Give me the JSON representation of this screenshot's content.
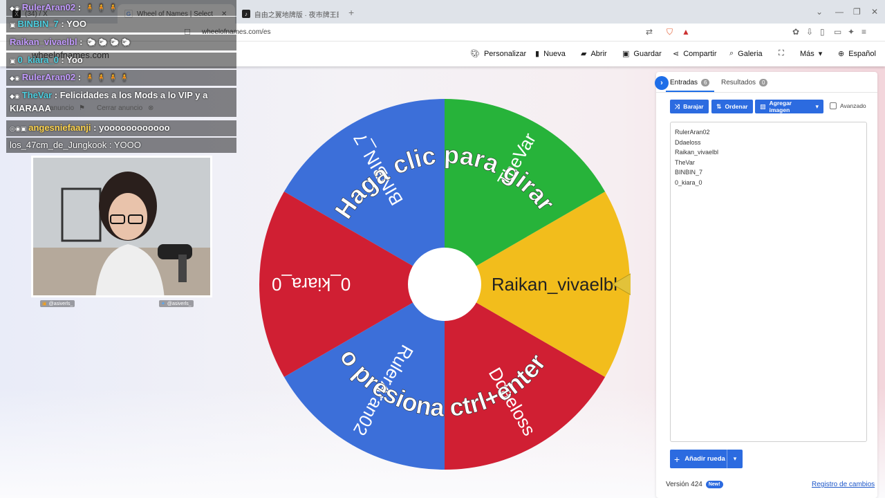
{
  "browser": {
    "tabs": [
      {
        "label": "(34) / X",
        "icon": "x-logo-icon",
        "active": false
      },
      {
        "label": "Wheel of Names | Selector de...",
        "icon": "google-icon",
        "active": true
      },
      {
        "label": "自由之翼地牌版 · 夜市牌王即兴版",
        "icon": "tiktok-icon",
        "active": false
      }
    ],
    "url": "wheelofnames.com/es",
    "site_title": "wheelofnames.com"
  },
  "navbar": {
    "items": [
      {
        "label": "Personalizar",
        "icon": "palette-icon"
      },
      {
        "label": "Nueva",
        "icon": "file-icon"
      },
      {
        "label": "Abrir",
        "icon": "folder-icon"
      },
      {
        "label": "Guardar",
        "icon": "save-icon"
      },
      {
        "label": "Compartir",
        "icon": "share-icon"
      },
      {
        "label": "Galeria",
        "icon": "search-icon"
      },
      {
        "label": "",
        "icon": "fullscreen-icon"
      },
      {
        "label": "Más",
        "icon": "chevron-down-icon"
      },
      {
        "label": "Español",
        "icon": "globe-icon"
      }
    ]
  },
  "ad": {
    "anuncio": "anuncio",
    "cerrar": "Cerrar anuncio"
  },
  "wheel": {
    "center_text_top": "Haga clic para girar",
    "center_text_bottom": "o presiona ctrl+enter",
    "colors": {
      "blue": "#3c6fd9",
      "green": "#27b33a",
      "yellow": "#f2bd1c",
      "red": "#d01f33"
    },
    "segments": [
      {
        "label": "RulerAran02",
        "color": "#3c6fd9"
      },
      {
        "label": "Ddaeloss",
        "color": "#d01f33"
      },
      {
        "label": "Raikan_vivaelbl",
        "color": "#f2bd1c"
      },
      {
        "label": "TheVar",
        "color": "#27b33a"
      },
      {
        "label": "BINBIN_7",
        "color": "#3c6fd9"
      },
      {
        "label": "0_kiara_0",
        "color": "#d01f33"
      }
    ]
  },
  "panel": {
    "tab_entries": "Entradas",
    "entries_count": "6",
    "tab_results": "Resultados",
    "results_count": "0",
    "btn_shuffle": "Barajar",
    "btn_sort": "Ordenar",
    "btn_add_image": "Agregar imagen",
    "advanced": "Avanzado",
    "entries": [
      "RulerAran02",
      "Ddaeloss",
      "Raikan_vivaelbl",
      "TheVar",
      "BINBIN_7",
      "0_kiara_0"
    ],
    "add_wheel": "Añadir rueda",
    "version": "Versión 424",
    "new_badge": "New!",
    "changelog": "Registro de cambios"
  },
  "chat": [
    {
      "user": "RulerAran02",
      "color": "#c39bff",
      "message": "",
      "emote": "🧍 🧍 🧍"
    },
    {
      "user": "BINBIN_7",
      "color": "#4dd0e1",
      "message": "YOO",
      "emote": ""
    },
    {
      "user": "Raikan_vivaelbl",
      "color": "#c39bff",
      "message": "",
      "emote": "🐑 🐑 🐑 🐑"
    },
    {
      "user": "0_kiara_0",
      "color": "#4dd0e1",
      "message": "Yoo",
      "emote": ""
    },
    {
      "user": "RulerAran02",
      "color": "#c39bff",
      "message": "",
      "emote": "🧍 🧍 🧍 🧍"
    },
    {
      "user": "TheVar",
      "color": "#4dd0e1",
      "message": "Felicidades a los Mods a lo VIP y a KIARAAA",
      "emote": ""
    },
    {
      "user": "angesniefaanji",
      "color": "#ffd54f",
      "message": "yoooooooooooo",
      "emote": ""
    },
    {
      "user": "los_47cm_de_Jungkook",
      "color": "#ffffff",
      "message": "YOOO",
      "emote": ""
    }
  ],
  "cam": {
    "social_left": "@asiverls_",
    "social_right": "@asiverls_"
  }
}
